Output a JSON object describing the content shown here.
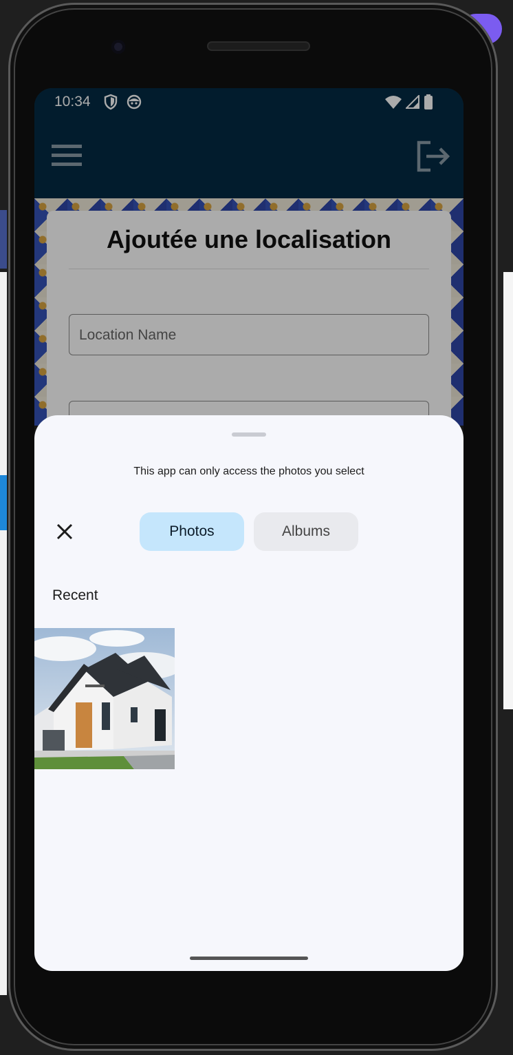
{
  "status_bar": {
    "time": "10:34"
  },
  "app_bar": {
    "menu_icon": "hamburger-menu-icon",
    "logout_icon": "logout-icon"
  },
  "form": {
    "title": "Ajoutée une localisation",
    "location_name_placeholder": "Location Name"
  },
  "photo_picker": {
    "notice": "This app can only access the photos you select",
    "tabs": [
      {
        "label": "Photos",
        "selected": true
      },
      {
        "label": "Albums",
        "selected": false
      }
    ],
    "section_label": "Recent",
    "photos": [
      {
        "description_icon": "house-photo"
      }
    ]
  },
  "colors": {
    "app_bar": "#032b43",
    "selected_tab": "#c5e6fc",
    "unselected_tab": "#e9eaee",
    "sheet_background": "#f6f7fc"
  }
}
